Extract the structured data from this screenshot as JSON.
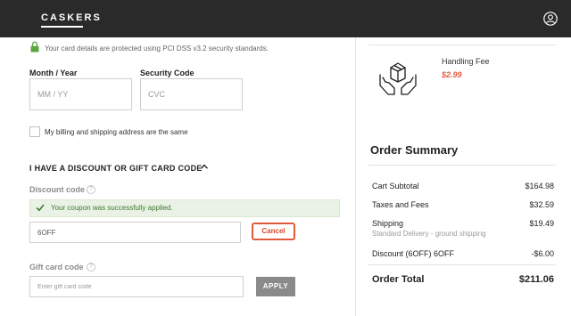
{
  "header": {
    "logo": "CASKERS",
    "user_icon": "user-circle-icon"
  },
  "payment": {
    "security_notice": "Your card details are protected using PCI DSS v3.2 security standards.",
    "month_year_label": "Month / Year",
    "month_year_placeholder": "MM / YY",
    "security_code_label": "Security Code",
    "security_code_placeholder": "CVC",
    "billing_same_label": "My billing and shipping address are the same",
    "billing_same_checked": false
  },
  "discount": {
    "section_title": "I HAVE A DISCOUNT OR GIFT CARD CODE",
    "discount_label": "Discount code",
    "help_glyph": "?",
    "success_message": "Your coupon was successfully applied.",
    "discount_value": "6OFF",
    "cancel_label": "Cancel",
    "gift_label": "Gift card code",
    "gift_placeholder": "Enter gift card code",
    "apply_label": "APPLY"
  },
  "handling": {
    "title": "Handling Fee",
    "price": "$2.99",
    "icon": "box-in-hands-icon"
  },
  "summary": {
    "title": "Order Summary",
    "rows": [
      {
        "label": "Cart Subtotal",
        "value": "$164.98"
      },
      {
        "label": "Taxes and Fees",
        "value": "$32.59"
      },
      {
        "label": "Shipping",
        "value": "$19.49",
        "sub": "Standard Delivery - ground shipping"
      },
      {
        "label": "Discount (6OFF) 6OFF",
        "value": "-$6.00"
      }
    ],
    "total_label": "Order Total",
    "total_value": "$211.06"
  },
  "colors": {
    "accent": "#e25a3c",
    "success": "#3d7a2e",
    "header_bg": "#2a2a2a"
  }
}
